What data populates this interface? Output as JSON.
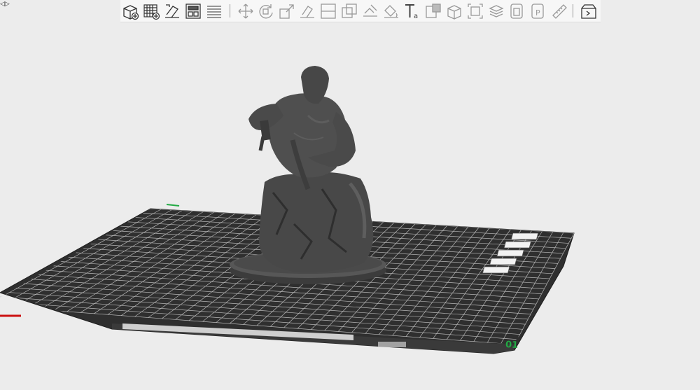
{
  "window": {
    "collapse_icon": "◁▷"
  },
  "toolbar": {
    "groups": [
      [
        "add-object",
        "add-plate",
        "auto-orient",
        "arrange",
        "split-layers"
      ],
      [
        "move",
        "rotate",
        "scale",
        "lay-on-face",
        "cut",
        "boolean",
        "support-paint",
        "seam-paint",
        "text",
        "mesh-boolean",
        "assembly",
        "measure",
        "variable-layer-height",
        "mirror",
        "placeholder",
        "ruler"
      ],
      [
        "slice-view"
      ]
    ]
  },
  "plate": {
    "grid_color": "#ffffff",
    "bed_color": "#2e2e2e",
    "model_color": "#4b4b4b",
    "plate_number": "01",
    "axis_x_color": "#cc1111",
    "axis_y_color": "#22aa44"
  },
  "plate_side_icons": [
    "close-icon",
    "orient-icon",
    "arrange-icon",
    "lock-icon",
    "settings-icon"
  ]
}
